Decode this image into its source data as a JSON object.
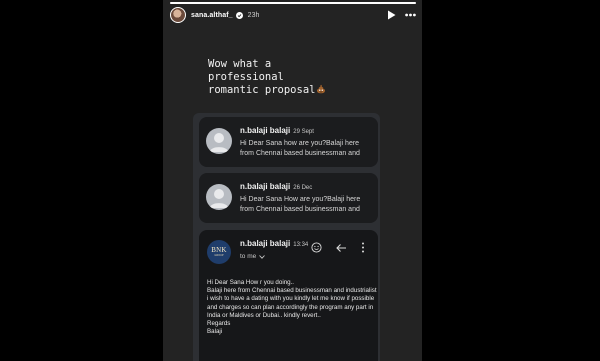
{
  "story": {
    "username": "sana.althaf_",
    "time_ago": "23h",
    "progress_fraction": 1.0,
    "caption": "Wow what a\nprofessional\nromantic proposal",
    "caption_emoji": "pile-of-poo-emoji"
  },
  "inbox": {
    "messages": [
      {
        "sender": "n.balaji balaji",
        "date": "29 Sept",
        "preview": "Hi Dear Sana how are you?Balaji here from Chennai based businessman and"
      },
      {
        "sender": "n.balaji balaji",
        "date": "26 Dec",
        "preview": "Hi Dear Sana How are you?Balaji here from Chennai based businessman and"
      }
    ],
    "open_email": {
      "sender": "n.balaji balaji",
      "time": "13:34",
      "to": "to me",
      "logo_text": "BNK",
      "logo_sub": "GROUP",
      "body": "Hi Dear Sana How r you doing..\nBalaji here from Chennai based businessman and industrialist i wish to have a dating with you kindly let me know if possible and charges so can plan accordingly the program any part in India or Maldives or Dubai.. kindly revert..\nRegards\nBalaji"
    }
  },
  "colors": {
    "background": "#000000",
    "story_panel": "#232323",
    "email_card": "#1b1c1e",
    "logo_navy": "#1f3d6b"
  }
}
